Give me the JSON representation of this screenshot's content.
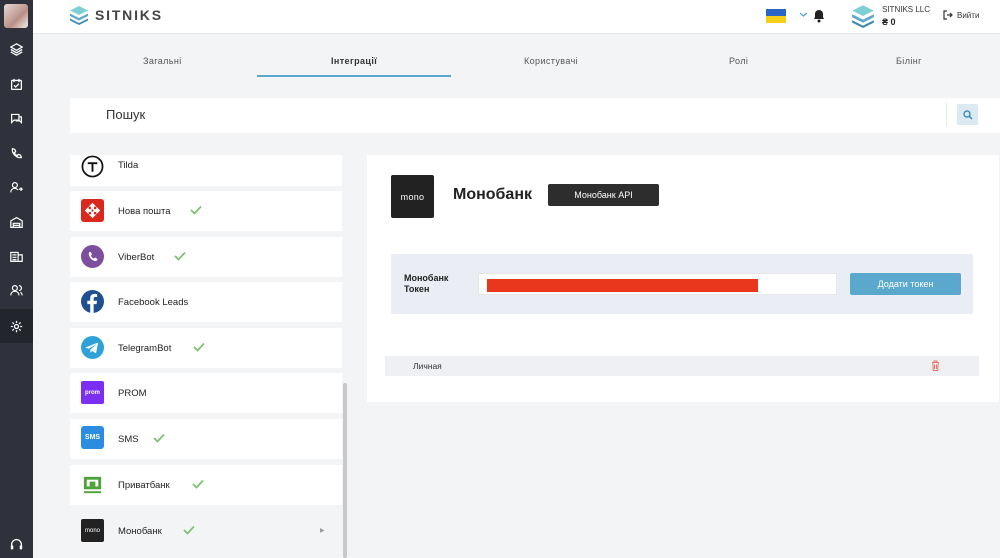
{
  "app": {
    "brand": "SITNIKS",
    "company": "SITNIKS LLC",
    "balance": "₴ 0",
    "logout_label": "Вийти",
    "accent_color": "#5aa8cc",
    "sidebar_icons": [
      "layers-icon",
      "calendar-icon",
      "chat-icon",
      "phone-icon",
      "user-swap-icon",
      "warehouse-icon",
      "ledger-icon",
      "users-icon",
      "settings-icon",
      "headset-icon"
    ]
  },
  "tabs": [
    {
      "label": "Загальні"
    },
    {
      "label": "Інтеграції",
      "active": true
    },
    {
      "label": "Користувачі"
    },
    {
      "label": "Ролі"
    },
    {
      "label": "Білінг"
    }
  ],
  "search": {
    "placeholder": "Пошук"
  },
  "integrations": [
    {
      "label": "Tilda",
      "connected": false
    },
    {
      "label": "Нова пошта",
      "connected": true
    },
    {
      "label": "ViberBot",
      "connected": true
    },
    {
      "label": "Facebook Leads",
      "connected": false
    },
    {
      "label": "TelegramBot",
      "connected": true
    },
    {
      "label": "PROM",
      "connected": false
    },
    {
      "label": "SMS",
      "connected": true
    },
    {
      "label": "Приватбанк",
      "connected": true
    },
    {
      "label": "Монобанк",
      "connected": true,
      "selected": true
    }
  ],
  "icon_texts": {
    "prom": "prom",
    "sms": "SMS",
    "mono": "mono"
  },
  "detail": {
    "logo_text": "mono",
    "title": "Монобанк",
    "api_button": "Монобанк API",
    "token_label": "Монобанк Токен",
    "add_token_button": "Додати токен",
    "tokens": [
      {
        "name": "Личная"
      }
    ]
  }
}
